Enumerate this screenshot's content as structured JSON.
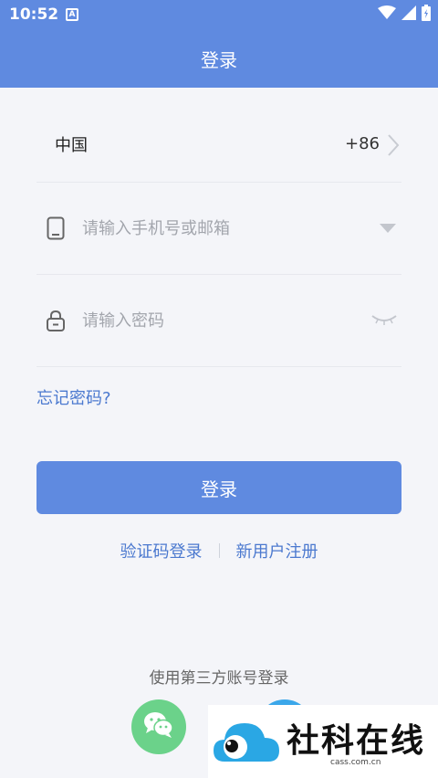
{
  "status_bar": {
    "time": "10:52",
    "notification_icon": "a-box-icon",
    "indicators": [
      "wifi-icon",
      "signal-icon",
      "battery-icon"
    ]
  },
  "header": {
    "title": "登录"
  },
  "form": {
    "country": {
      "name": "中国",
      "code": "+86"
    },
    "phone": {
      "placeholder": "请输入手机号或邮箱",
      "value": ""
    },
    "password": {
      "placeholder": "请输入密码",
      "value": ""
    },
    "forgot_label": "忘记密码?",
    "login_label": "登录"
  },
  "alt_links": {
    "code_login": "验证码登录",
    "register": "新用户注册"
  },
  "third_party": {
    "label": "使用第三方账号登录"
  },
  "watermark": {
    "text": "社科在线",
    "domain": "cass.com.cn"
  },
  "colors": {
    "primary": "#5f8ae0",
    "link": "#4b79cf",
    "background": "#f4f5f9",
    "wechat": "#6bd28a"
  }
}
